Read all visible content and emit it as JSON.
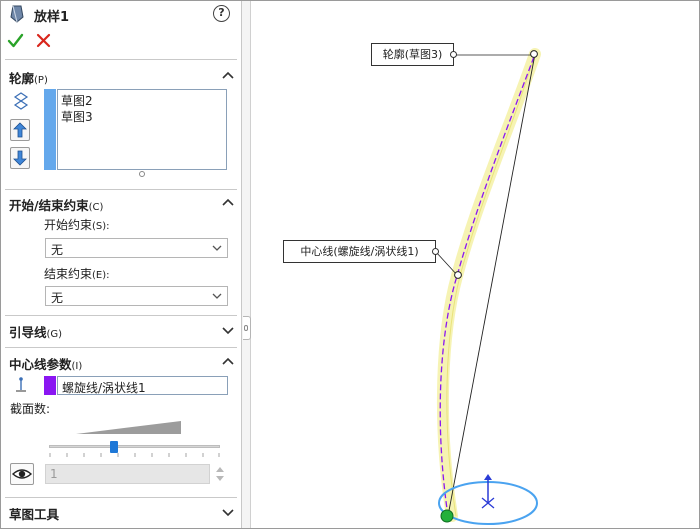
{
  "panel": {
    "title": "放样1",
    "help": "?",
    "ok_icon": "check-icon",
    "cancel_icon": "close-icon"
  },
  "profiles": {
    "title": "轮廓",
    "title_shortcut": "(P)",
    "items": [
      "草图2",
      "草图3"
    ]
  },
  "constraints": {
    "title": "开始/结束约束",
    "title_shortcut": "(C)",
    "start_label": "开始约束",
    "start_shortcut": "(S):",
    "start_value": "无",
    "end_label": "结束约束",
    "end_shortcut": "(E):",
    "end_value": "无"
  },
  "guides": {
    "title": "引导线",
    "title_shortcut": "(G)"
  },
  "centerline": {
    "title": "中心线参数",
    "title_shortcut": "(I)",
    "value": "螺旋线/涡状线1",
    "sections_label": "截面数:",
    "spin_value": "1"
  },
  "sketch_tools": {
    "title": "草图工具"
  },
  "viewport": {
    "callout_profile": "轮廓(草图3)",
    "callout_centerline": "中心线(螺旋线/涡状线1)"
  },
  "colors": {
    "accent_blue": "#64a8ec",
    "centerline_purple": "#8a16f2",
    "ok_green": "#2aa329",
    "cancel_red": "#d9261c",
    "preview_yellow": "#f3ef9a",
    "ellipse_blue": "#4aa3f0"
  }
}
